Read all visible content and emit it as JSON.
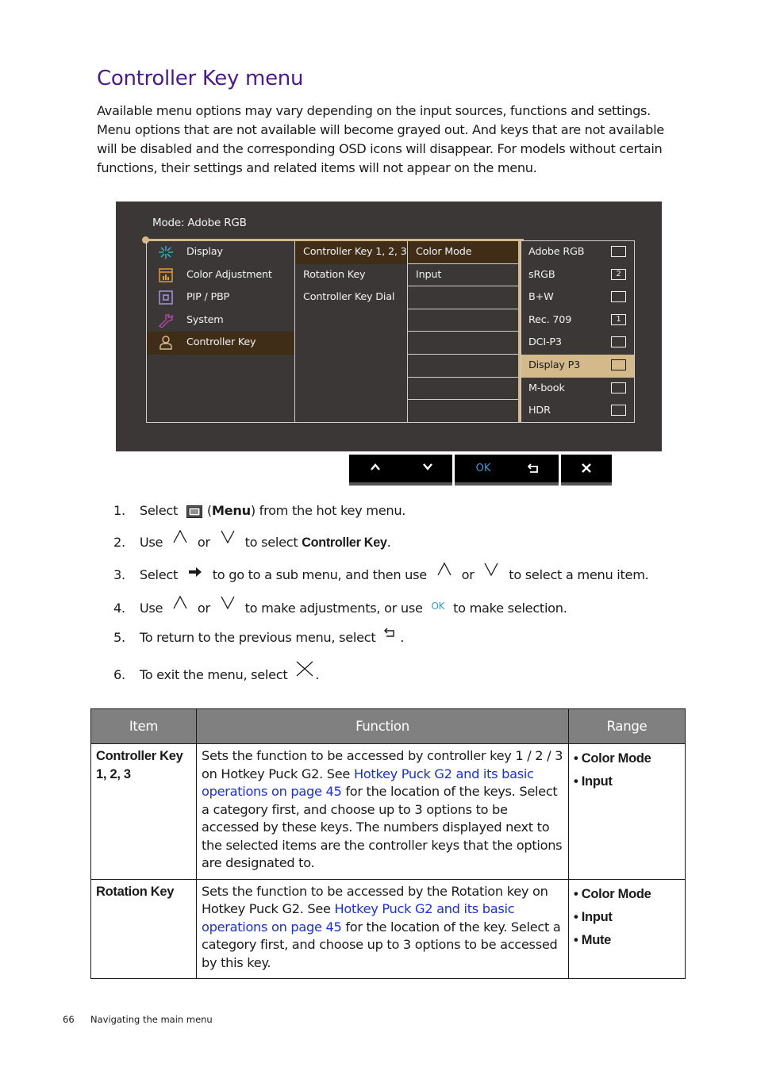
{
  "page": {
    "title": "Controller Key menu",
    "intro": "Available menu options may vary depending on the input sources, functions and settings. Menu options that are not available will become grayed out. And keys that are not available will be disabled and the corresponding OSD icons will disappear. For models without certain functions, their settings and related items will not appear on the menu."
  },
  "osd": {
    "mode_label": "Mode: Adobe RGB",
    "accent_color": "#d4b98a",
    "main_menu": [
      {
        "label": "Display",
        "icon": "display-icon",
        "color": "#3fb8d0"
      },
      {
        "label": "Color Adjustment",
        "icon": "color-adjustment-icon",
        "color": "#e89a2c"
      },
      {
        "label": "PIP / PBP",
        "icon": "pip-pbp-icon",
        "color": "#9b8fd0"
      },
      {
        "label": "System",
        "icon": "system-wrench-icon",
        "color": "#b04aa6"
      },
      {
        "label": "Controller Key",
        "icon": "controller-key-person-icon",
        "color": "#d4b98a",
        "selected": true
      }
    ],
    "sub_menu": [
      {
        "label": "Controller Key 1, 2, 3",
        "selected": true
      },
      {
        "label": "Rotation Key"
      },
      {
        "label": "Controller Key Dial"
      }
    ],
    "category_menu": [
      {
        "label": "Color Mode",
        "selected": true
      },
      {
        "label": "Input"
      },
      {
        "label": ""
      },
      {
        "label": ""
      },
      {
        "label": ""
      },
      {
        "label": ""
      },
      {
        "label": ""
      },
      {
        "label": ""
      }
    ],
    "options": [
      {
        "label": "Adobe RGB",
        "key": ""
      },
      {
        "label": "sRGB",
        "key": "2"
      },
      {
        "label": "B+W",
        "key": ""
      },
      {
        "label": "Rec. 709",
        "key": "1"
      },
      {
        "label": "DCI-P3",
        "key": ""
      },
      {
        "label": "Display P3",
        "key": "",
        "highlighted": true
      },
      {
        "label": "M-book",
        "key": ""
      },
      {
        "label": "HDR",
        "key": ""
      }
    ],
    "keys": {
      "up": "up-chevron-icon",
      "down": "down-chevron-icon",
      "ok": "OK",
      "back": "back-return-icon",
      "exit": "close-x-icon"
    }
  },
  "steps": [
    {
      "num": "1.",
      "parts": [
        "Select",
        "(",
        "Menu",
        ") from the hot key menu."
      ]
    },
    {
      "num": "2.",
      "parts": [
        "Use",
        "or",
        "to select",
        "Controller Key",
        "."
      ]
    },
    {
      "num": "3.",
      "parts": [
        "Select",
        "to go to a sub menu, and then use",
        "or",
        "to select a menu item."
      ]
    },
    {
      "num": "4.",
      "parts": [
        "Use",
        "or",
        "to make adjustments, or use",
        "OK",
        "to make selection."
      ]
    },
    {
      "num": "5.",
      "parts": [
        "To return to the previous menu, select",
        "."
      ]
    },
    {
      "num": "6.",
      "parts": [
        "To exit the menu, select",
        "."
      ]
    }
  ],
  "table": {
    "headers": [
      "Item",
      "Function",
      "Range"
    ],
    "rows": [
      {
        "item": "Controller Key 1, 2, 3",
        "function_pre": "Sets the function to be accessed by controller key 1 / 2 / 3 on Hotkey Puck G2. See ",
        "function_link": "Hotkey Puck G2 and its basic operations on page 45",
        "function_post": " for the location of the keys. Select a category first, and choose up to 3 options to be accessed by these keys. The numbers displayed next to the selected items are the controller keys that the options are designated to.",
        "range": [
          "Color Mode",
          "Input"
        ]
      },
      {
        "item": "Rotation Key",
        "function_pre": "Sets the function to be accessed by the Rotation key on Hotkey Puck G2. See ",
        "function_link": "Hotkey Puck G2 and its basic operations on page 45",
        "function_post": " for the location of the key. Select a category first, and choose up to 3 options to be accessed by this key.",
        "range": [
          "Color Mode",
          "Input",
          "Mute"
        ]
      }
    ]
  },
  "footer": {
    "page_number": "66",
    "section": "Navigating the main menu"
  }
}
